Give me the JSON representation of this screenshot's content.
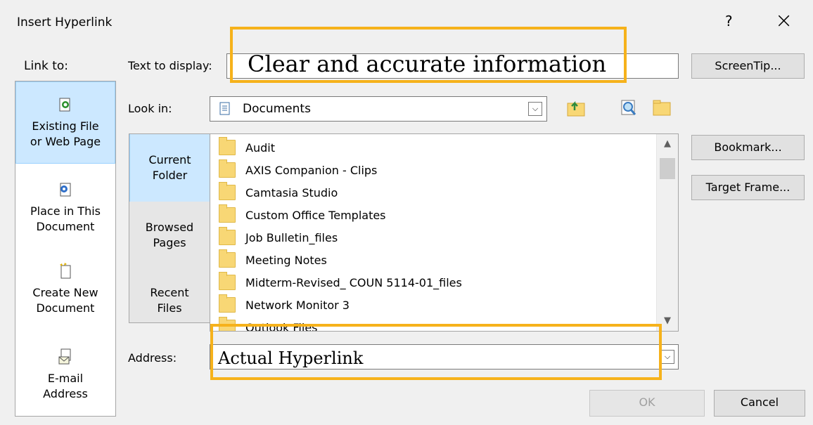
{
  "window": {
    "title": "Insert Hyperlink",
    "help": "?",
    "close": "×"
  },
  "link_to": {
    "label": "Link to:",
    "items": [
      {
        "line1": "Existing File",
        "line2": "or Web Page",
        "icon": "existing-file-icon",
        "selected": true
      },
      {
        "line1": "Place in This",
        "line2": "Document",
        "icon": "place-in-document-icon",
        "selected": false
      },
      {
        "line1": "Create New",
        "line2": "Document",
        "icon": "create-new-document-icon",
        "selected": false
      },
      {
        "line1": "E-mail",
        "line2": "Address",
        "icon": "email-address-icon",
        "selected": false
      }
    ]
  },
  "text_to_display": {
    "label": "Text to display:",
    "value": "Clear and accurate information"
  },
  "look_in": {
    "label": "Look in:",
    "value": "Documents"
  },
  "nav": [
    {
      "line1": "Current",
      "line2": "Folder",
      "selected": true
    },
    {
      "line1": "Browsed",
      "line2": "Pages",
      "selected": false
    },
    {
      "line1": "Recent",
      "line2": "Files",
      "selected": false
    }
  ],
  "files": [
    "Audit",
    "AXIS Companion - Clips",
    "Camtasia Studio",
    "Custom Office Templates",
    "Job Bulletin_files",
    "Meeting Notes",
    "Midterm-Revised_ COUN 5114-01_files",
    "Network Monitor 3",
    "Outlook Files"
  ],
  "address": {
    "label": "Address:",
    "value": "Actual Hyperlink"
  },
  "buttons": {
    "screentip": "ScreenTip...",
    "bookmark": "Bookmark...",
    "target_frame": "Target Frame...",
    "ok": "OK",
    "cancel": "Cancel"
  },
  "colors": {
    "highlight_border": "#f6b21b",
    "selection": "#cce8ff"
  }
}
